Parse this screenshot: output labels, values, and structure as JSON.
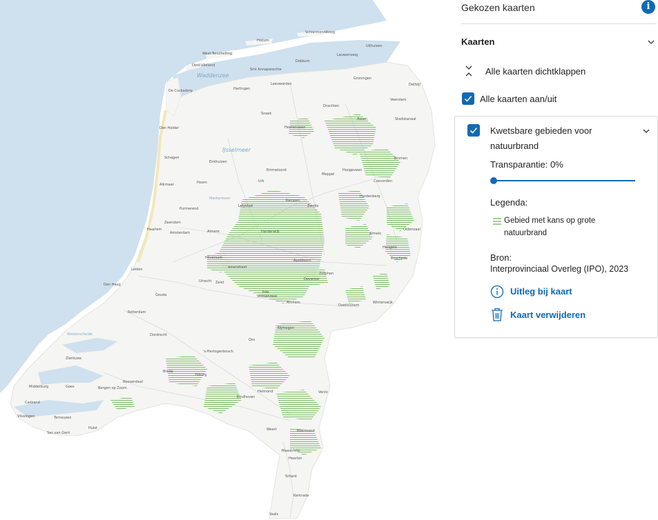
{
  "panel": {
    "title": "Gekozen kaarten",
    "info_icon": "info-icon",
    "section_title": "Kaarten",
    "collapse_all_label": "Alle kaarten dichtklappen",
    "toggle_all_label": "Alle kaarten aan/uit",
    "toggle_all_checked": true
  },
  "layer": {
    "title": "Kwetsbare gebieden voor natuurbrand",
    "checked": true,
    "transparency_label": "Transparantie: 0%",
    "transparency_value": 0,
    "legend_label": "Legenda:",
    "legend_item": "Gebied met kans op grote natuurbrand",
    "legend_color": "#5fae4a",
    "source_label": "Bron:",
    "source_value": "Interprovinciaal Overleg (IPO), 2023",
    "explain_label": "Uitleg bij kaart",
    "remove_label": "Kaart verwijderen"
  },
  "colors": {
    "accent": "#0f6ab4",
    "water": "#c8dcec",
    "land": "#f4f4f2",
    "hatch": "#5fae4a"
  },
  "map": {
    "water_labels": [
      "Waddenzee",
      "IJsselmeer",
      "Markermeer",
      "Oosterschelde",
      "Westerschelde"
    ],
    "places": [
      "Schiermonnikoog",
      "Hollum",
      "West-Terschelling",
      "Dokkum",
      "Uithuizen",
      "Lauwersoog",
      "Delfzijl",
      "Oost-Vlieland",
      "Sint Annaparochie",
      "Leeuwarden",
      "Groningen",
      "Harlingen",
      "Drachten",
      "Veendam",
      "De Cocksdorp",
      "Sneek",
      "Assen",
      "Stadskanaal",
      "Den Helder",
      "Heerenveen",
      "Emmen",
      "Hoorn",
      "Enkhuizen",
      "Lelystad",
      "Zwolle",
      "Almere",
      "Amsterdam",
      "Haarlem",
      "Leiden",
      "Den Haag",
      "Utrecht",
      "Amersfoort",
      "Apeldoorn",
      "Deventer",
      "Enschede",
      "Hengelo",
      "Arnhem",
      "Nijmegen",
      "Ede",
      "Rotterdam",
      "Dordrecht",
      "Gouda",
      "Breda",
      "Tilburg",
      "'s-Hertogenbosch",
      "Eindhoven",
      "Helmond",
      "Venlo",
      "Roermond",
      "Maastricht",
      "Heerlen",
      "Middelburg",
      "Vlissingen",
      "Goes",
      "Terneuzen",
      "Bergen op Zoom",
      "Roosendaal",
      "Oss",
      "Zutphen",
      "Doetinchem",
      "Winterswijk",
      "Harderwijk",
      "Hilversum",
      "Zeist",
      "Veenendaal",
      "Alkmaar",
      "Schagen",
      "Zaandam",
      "Purmerend",
      "Emmeloord",
      "Kampen",
      "Meppel",
      "Hoogeveen",
      "Coevorden",
      "Hardenberg",
      "Almelo",
      "Oldenzaal",
      "Urk",
      "Zierikzee",
      "Hulst",
      "Sas van Gent",
      "Cadzand",
      "Weert",
      "Sittard",
      "Kerkrade",
      "Vaals"
    ]
  }
}
